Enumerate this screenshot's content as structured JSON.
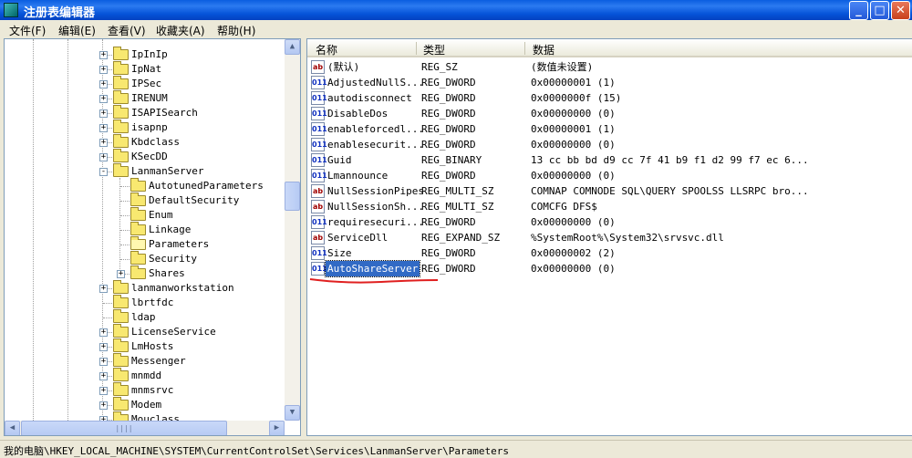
{
  "window": {
    "title": "注册表编辑器",
    "minimize": "_",
    "maximize": "□",
    "close": "✕"
  },
  "menu": [
    "文件(F)",
    "编辑(E)",
    "查看(V)",
    "收藏夹(A)",
    "帮助(H)"
  ],
  "tree": [
    {
      "label": "IpInIp",
      "level": 0,
      "expander": "+"
    },
    {
      "label": "IpNat",
      "level": 0,
      "expander": "+"
    },
    {
      "label": "IPSec",
      "level": 0,
      "expander": "+"
    },
    {
      "label": "IRENUM",
      "level": 0,
      "expander": "+"
    },
    {
      "label": "ISAPISearch",
      "level": 0,
      "expander": "+"
    },
    {
      "label": "isapnp",
      "level": 0,
      "expander": "+"
    },
    {
      "label": "Kbdclass",
      "level": 0,
      "expander": "+"
    },
    {
      "label": "KSecDD",
      "level": 0,
      "expander": "+"
    },
    {
      "label": "LanmanServer",
      "level": 0,
      "expander": "-"
    },
    {
      "label": "AutotunedParameters",
      "level": 1,
      "expander": ""
    },
    {
      "label": "DefaultSecurity",
      "level": 1,
      "expander": ""
    },
    {
      "label": "Enum",
      "level": 1,
      "expander": ""
    },
    {
      "label": "Linkage",
      "level": 1,
      "expander": ""
    },
    {
      "label": "Parameters",
      "level": 1,
      "expander": "",
      "open": true
    },
    {
      "label": "Security",
      "level": 1,
      "expander": ""
    },
    {
      "label": "Shares",
      "level": 1,
      "expander": "+"
    },
    {
      "label": "lanmanworkstation",
      "level": 0,
      "expander": "+"
    },
    {
      "label": "lbrtfdc",
      "level": 0,
      "expander": ""
    },
    {
      "label": "ldap",
      "level": 0,
      "expander": ""
    },
    {
      "label": "LicenseService",
      "level": 0,
      "expander": "+"
    },
    {
      "label": "LmHosts",
      "level": 0,
      "expander": "+"
    },
    {
      "label": "Messenger",
      "level": 0,
      "expander": "+"
    },
    {
      "label": "mnmdd",
      "level": 0,
      "expander": "+"
    },
    {
      "label": "mnmsrvc",
      "level": 0,
      "expander": "+"
    },
    {
      "label": "Modem",
      "level": 0,
      "expander": "+"
    },
    {
      "label": "Mouclass",
      "level": 0,
      "expander": "+"
    }
  ],
  "scrollbar": {
    "up": "▲",
    "down": "▼",
    "left": "◀",
    "right": "▶",
    "grip": "||||"
  },
  "list": {
    "headers": {
      "name": "名称",
      "type": "类型",
      "data": "数据"
    },
    "rows": [
      {
        "icon": "ab",
        "name": "(默认)",
        "type": "REG_SZ",
        "data": "(数值未设置)"
      },
      {
        "icon": "011",
        "name": "AdjustedNullS...",
        "type": "REG_DWORD",
        "data": "0x00000001 (1)"
      },
      {
        "icon": "011",
        "name": "autodisconnect",
        "type": "REG_DWORD",
        "data": "0x0000000f (15)"
      },
      {
        "icon": "011",
        "name": "DisableDos",
        "type": "REG_DWORD",
        "data": "0x00000000 (0)"
      },
      {
        "icon": "011",
        "name": "enableforcedl...",
        "type": "REG_DWORD",
        "data": "0x00000001 (1)"
      },
      {
        "icon": "011",
        "name": "enablesecurit...",
        "type": "REG_DWORD",
        "data": "0x00000000 (0)"
      },
      {
        "icon": "011",
        "name": "Guid",
        "type": "REG_BINARY",
        "data": "13 cc bb bd d9 cc 7f 41 b9 f1 d2 99 f7 ec 6..."
      },
      {
        "icon": "011",
        "name": "Lmannounce",
        "type": "REG_DWORD",
        "data": "0x00000000 (0)"
      },
      {
        "icon": "ab",
        "name": "NullSessionPipes",
        "type": "REG_MULTI_SZ",
        "data": "COMNAP COMNODE SQL\\QUERY SPOOLSS LLSRPC bro..."
      },
      {
        "icon": "ab",
        "name": "NullSessionSh...",
        "type": "REG_MULTI_SZ",
        "data": "COMCFG DFS$"
      },
      {
        "icon": "011",
        "name": "requiresecuri...",
        "type": "REG_DWORD",
        "data": "0x00000000 (0)"
      },
      {
        "icon": "ab",
        "name": "ServiceDll",
        "type": "REG_EXPAND_SZ",
        "data": "%SystemRoot%\\System32\\srvsvc.dll"
      },
      {
        "icon": "011",
        "name": "Size",
        "type": "REG_DWORD",
        "data": "0x00000002 (2)"
      },
      {
        "icon": "011",
        "name": "AutoShareServer",
        "type": "REG_DWORD",
        "data": "0x00000000 (0)",
        "selected": true
      }
    ]
  },
  "annotation_color": "#e02020",
  "status": "我的电脑\\HKEY_LOCAL_MACHINE\\SYSTEM\\CurrentControlSet\\Services\\LanmanServer\\Parameters"
}
